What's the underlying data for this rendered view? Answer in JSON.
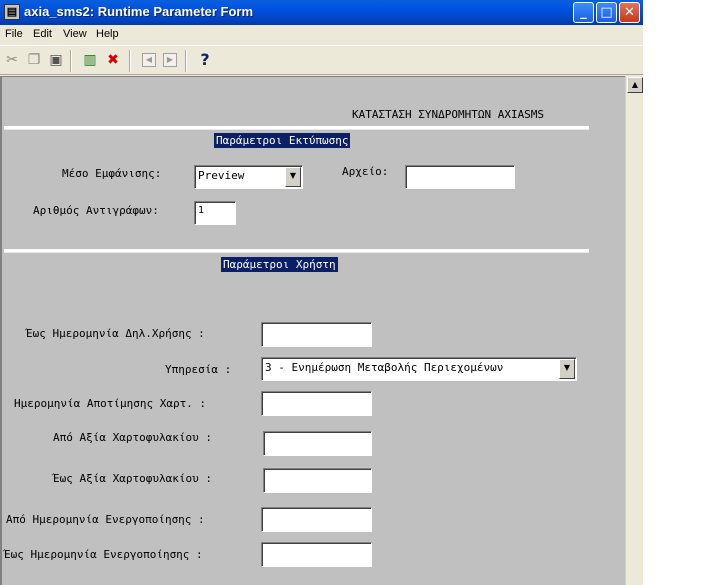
{
  "window": {
    "title": "axia_sms2: Runtime Parameter Form",
    "controls": {
      "minimize": "_",
      "maximize": "□",
      "close": "✕"
    }
  },
  "menu": {
    "items": [
      {
        "label": "File"
      },
      {
        "label": "Edit"
      },
      {
        "label": "View"
      },
      {
        "label": "Help"
      }
    ]
  },
  "toolbar": {
    "icons": [
      "cut-icon",
      "copy-icon",
      "paste-icon",
      "run-report-icon",
      "cancel-icon",
      "previous-page-icon",
      "next-page-icon",
      "help-icon"
    ],
    "help_glyph": "?",
    "cancel_glyph": "✖"
  },
  "form": {
    "report_title": "ΚΑΤΑΣΤΑΣΗ ΣΥΝΔΡΟΜΗΤΩΝ AXIASMS",
    "print_section": {
      "title": "Παράμετροι Εκτύπωσης",
      "destination_label": "Μέσο Εμφάνισης:",
      "destination_value": "Preview",
      "file_label": "Αρχείο:",
      "file_value": "",
      "copies_label": "Αριθμός Αντιγράφων:",
      "copies_value": "1"
    },
    "user_section": {
      "title": "Παράμετροι Χρήστη",
      "fields": [
        {
          "label": "Έως Ημερομηνία Δηλ.Χρήσης :",
          "value": ""
        },
        {
          "label": "Υπηρεσία :",
          "value": "3 - Ενημέρωση Μεταβολής Περιεχομένων"
        },
        {
          "label": "Ημερομηνία Αποτίμησης Χαρτ. :",
          "value": ""
        },
        {
          "label": "Από Αξία Χαρτοφυλακίου :",
          "value": ""
        },
        {
          "label": "Έως Αξία Χαρτοφυλακίου :",
          "value": ""
        },
        {
          "label": "Από Ημερομηνία Ενεργοποίησης :",
          "value": ""
        },
        {
          "label": "Έως Ημερομηνία Ενεργοποίησης :",
          "value": ""
        }
      ]
    }
  }
}
